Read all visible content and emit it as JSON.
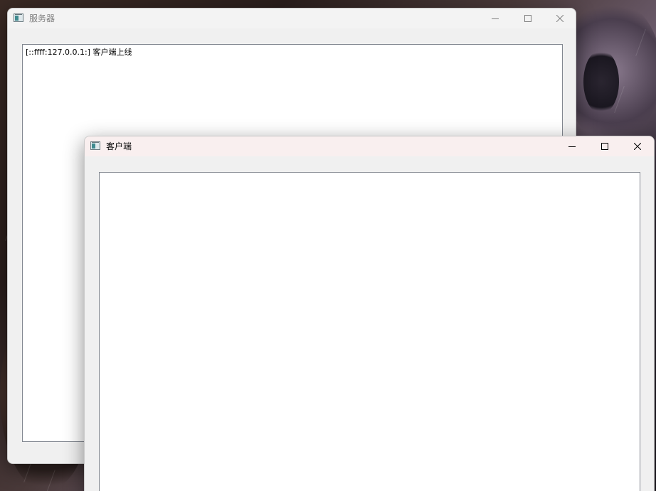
{
  "server_window": {
    "title": "服务器",
    "log_lines": [
      "[::ffff:127.0.0.1:] 客户端上线"
    ]
  },
  "client_window": {
    "title": "客户端",
    "log_text": ""
  },
  "caption_icons": {
    "minimize": "minimize-icon",
    "maximize": "maximize-icon",
    "close": "close-icon"
  },
  "colors": {
    "server_titlebar": "#f3f3f3",
    "client_titlebar": "#f9efef",
    "window_body": "#f0f0f0",
    "inactive_text": "#808080",
    "active_text": "#000000"
  }
}
